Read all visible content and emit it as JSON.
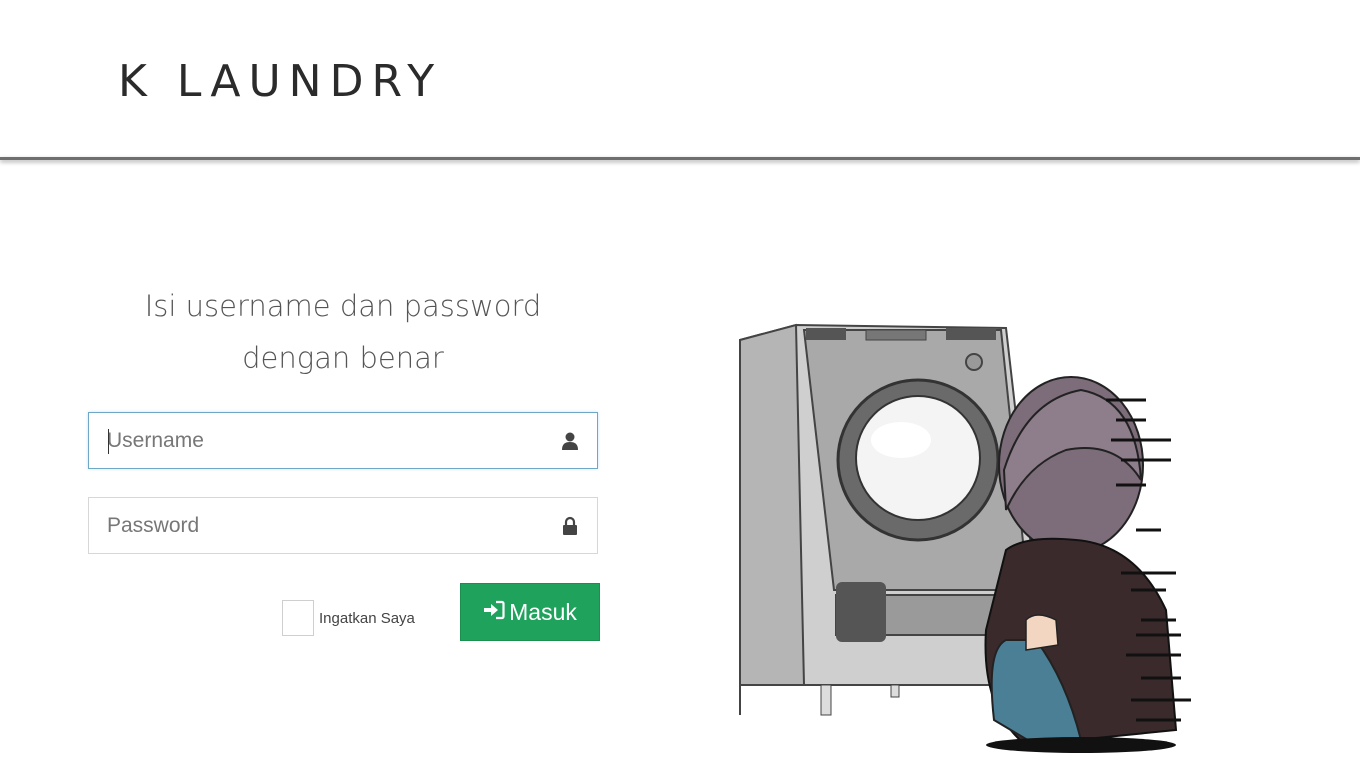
{
  "header": {
    "brand": "K LAUNDRY"
  },
  "login": {
    "heading_line1": "Isi username dan password",
    "heading_line2": "dengan benar",
    "username": {
      "placeholder": "Username",
      "value": "",
      "icon": "user-icon"
    },
    "password": {
      "placeholder": "Password",
      "value": "",
      "icon": "lock-icon"
    },
    "remember_label": "Ingatkan Saya",
    "remember_checked": false,
    "submit_label": "Masuk",
    "submit_icon": "sign-in-icon"
  },
  "colors": {
    "submit_bg": "#1fa35c",
    "focus_border": "#6fa8c6",
    "header_rule": "#6f6f6f"
  }
}
